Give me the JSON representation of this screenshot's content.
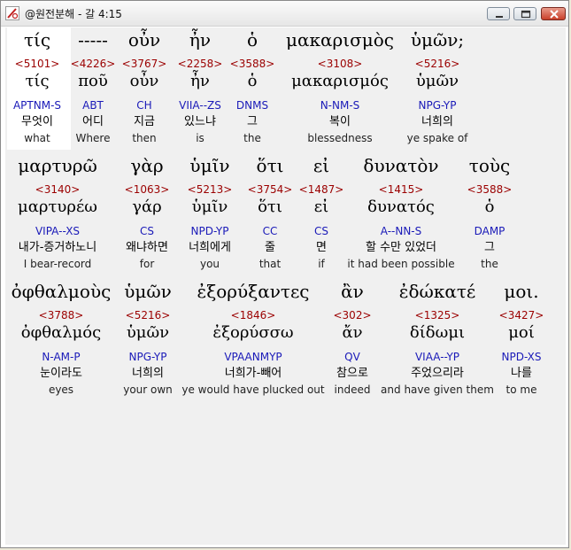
{
  "window": {
    "title": "@원전분해 - 갈 4:15",
    "controls": [
      "minimize",
      "maximize",
      "close"
    ]
  },
  "verse": {
    "rows": [
      {
        "words": [
          {
            "greek": "τίς",
            "strong": "<5101>",
            "lemma": "τίς",
            "morph": "APTNM-S",
            "korean": "무엇이",
            "english": "what",
            "highlighted": true
          },
          {
            "greek": "-----",
            "strong": "<4226>",
            "lemma": "ποῦ",
            "morph": "ABT",
            "korean": "어디",
            "english": "Where"
          },
          {
            "greek": "οὖν",
            "strong": "<3767>",
            "lemma": "οὖν",
            "morph": "CH",
            "korean": "지금",
            "english": "then"
          },
          {
            "greek": "ἦν",
            "strong": "<2258>",
            "lemma": "ἦν",
            "morph": "VIIA--ZS",
            "korean": "있느냐",
            "english": "is"
          },
          {
            "greek": "ὁ",
            "strong": "<3588>",
            "lemma": "ὁ",
            "morph": "DNMS",
            "korean": "그",
            "english": "the"
          },
          {
            "greek": "μακαρισμὸς",
            "strong": "<3108>",
            "lemma": "μακαρισμός",
            "morph": "N-NM-S",
            "korean": "복이",
            "english": "blessedness"
          },
          {
            "greek": "ὑμῶν;",
            "strong": "<5216>",
            "lemma": "ὑμῶν",
            "morph": "NPG-YP",
            "korean": "너희의",
            "english": "ye spake of"
          }
        ]
      },
      {
        "words": [
          {
            "greek": "μαρτυρῶ",
            "strong": "<3140>",
            "lemma": "μαρτυρέω",
            "morph": "VIPA--XS",
            "korean": "내가-증거하노니",
            "english": "I bear-record"
          },
          {
            "greek": "γὰρ",
            "strong": "<1063>",
            "lemma": "γάρ",
            "morph": "CS",
            "korean": "왜냐하면",
            "english": "for"
          },
          {
            "greek": "ὑμῖν",
            "strong": "<5213>",
            "lemma": "ὑμῖν",
            "morph": "NPD-YP",
            "korean": "너희에게",
            "english": "you"
          },
          {
            "greek": "ὅτι",
            "strong": "<3754>",
            "lemma": "ὅτι",
            "morph": "CC",
            "korean": "줄",
            "english": "that"
          },
          {
            "greek": "εἰ",
            "strong": "<1487>",
            "lemma": "εἰ",
            "morph": "CS",
            "korean": "면",
            "english": "if"
          },
          {
            "greek": "δυνατὸν",
            "strong": "<1415>",
            "lemma": "δυνατός",
            "morph": "A--NN-S",
            "korean": "할 수만 있었더",
            "english": "it had been possible"
          },
          {
            "greek": "τοὺς",
            "strong": "<3588>",
            "lemma": "ὁ",
            "morph": "DAMP",
            "korean": "그",
            "english": "the"
          }
        ]
      },
      {
        "words": [
          {
            "greek": "ὀφθαλμοὺς",
            "strong": "<3788>",
            "lemma": "ὀφθαλμός",
            "morph": "N-AM-P",
            "korean": "눈이라도",
            "english": "eyes"
          },
          {
            "greek": "ὑμῶν",
            "strong": "<5216>",
            "lemma": "ὑμῶν",
            "morph": "NPG-YP",
            "korean": "너희의",
            "english": "your own"
          },
          {
            "greek": "ἐξορύξαντες",
            "strong": "<1846>",
            "lemma": "ἐξορύσσω",
            "morph": "VPAANMYP",
            "korean": "너희가-빼어",
            "english": "ye would have plucked out"
          },
          {
            "greek": "ἂν",
            "strong": "<302>",
            "lemma": "ἄν",
            "morph": "QV",
            "korean": "참으로",
            "english": "indeed"
          },
          {
            "greek": "ἐδώκατέ",
            "strong": "<1325>",
            "lemma": "δίδωμι",
            "morph": "VIAA--YP",
            "korean": "주었으리라",
            "english": "and have given them"
          },
          {
            "greek": "μοι.",
            "strong": "<3427>",
            "lemma": "μοί",
            "morph": "NPD-XS",
            "korean": "나를",
            "english": "to me"
          }
        ]
      }
    ]
  }
}
